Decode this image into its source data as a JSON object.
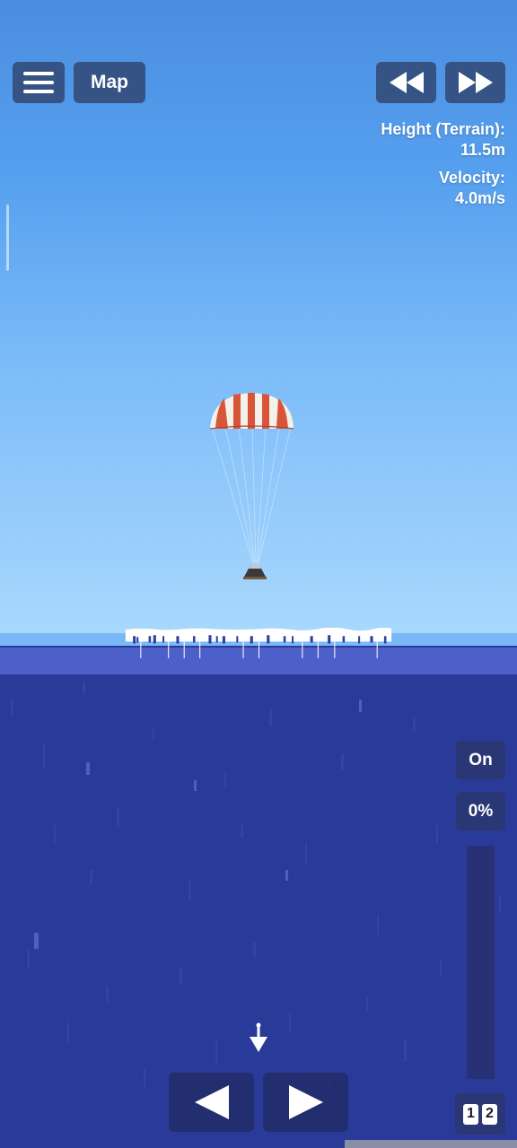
{
  "hud": {
    "map_label": "Map",
    "height_label": "Height (Terrain):",
    "height_value": "11.5m",
    "velocity_label": "Velocity:",
    "velocity_value": "4.0m/s"
  },
  "controls": {
    "toggle_label": "On",
    "throttle_label": "0%",
    "throttle_value": 0,
    "stage_left": "1",
    "stage_right": "2"
  },
  "icons": {
    "menu": "hamburger-icon",
    "rewind": "rewind-icon",
    "fast_forward": "fast-forward-icon",
    "rotate_left": "triangle-left-icon",
    "rotate_right": "triangle-right-icon",
    "marker": "arrow-down-icon"
  },
  "colors": {
    "sky_top": "#4b8ddf",
    "sky_bottom": "#a9d8fd",
    "ocean": "#2a3a98",
    "button_bg": "#2c3e64",
    "parachute_red": "#d9553a",
    "parachute_white": "#f4f0ea"
  }
}
